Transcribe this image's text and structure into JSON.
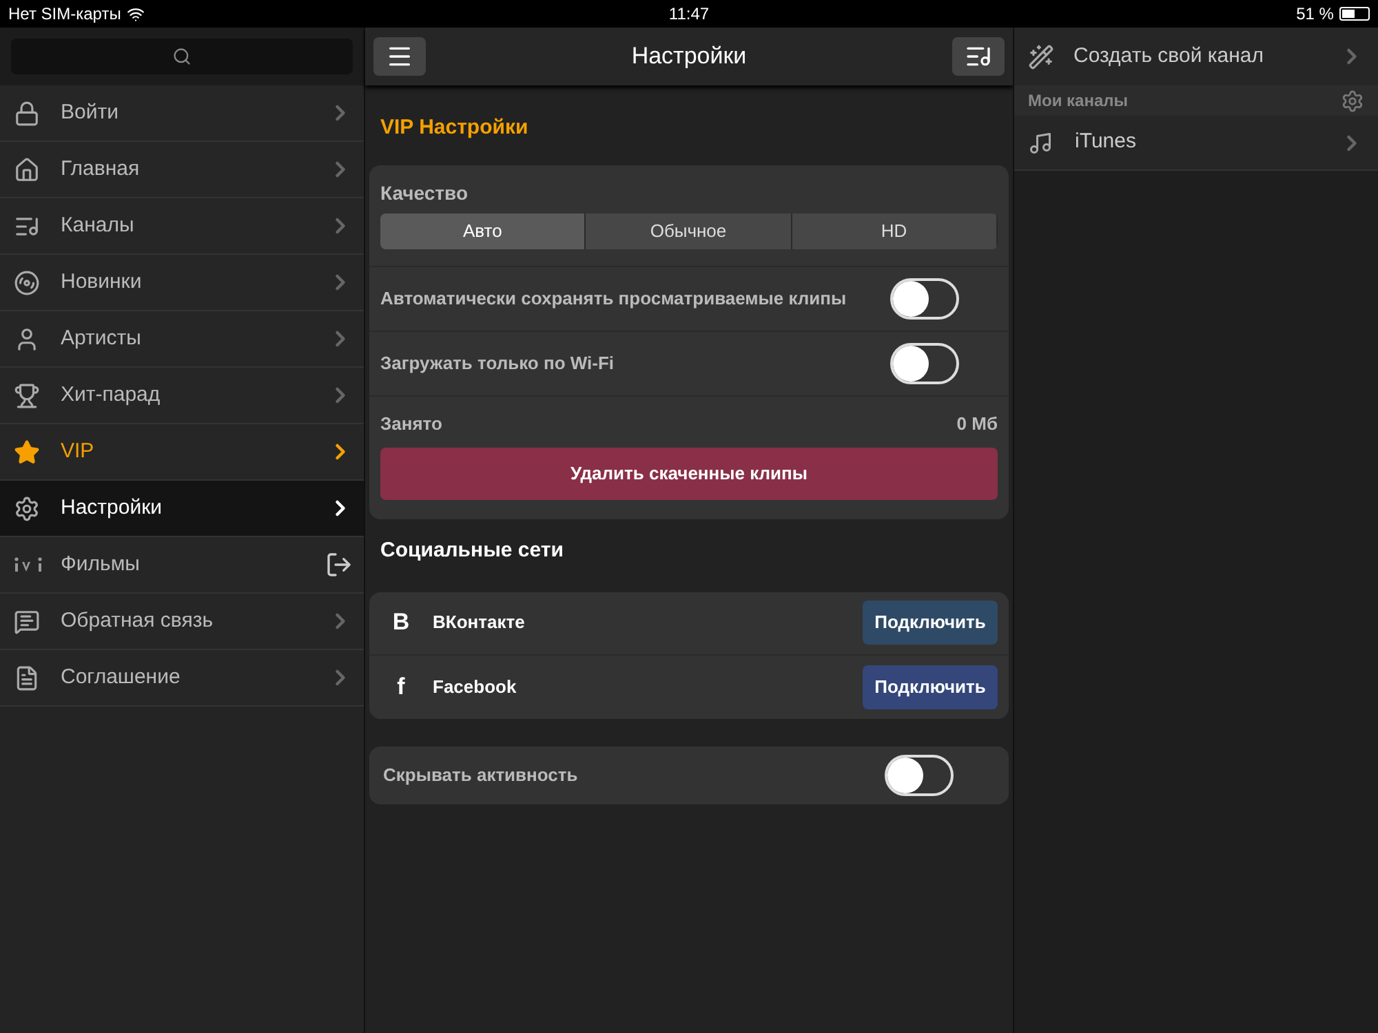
{
  "status_bar": {
    "carrier": "Нет SIM-карты",
    "time": "11:47",
    "battery": "51 %"
  },
  "sidebar": {
    "items": [
      {
        "label": "Войти",
        "selected": false,
        "accent": false,
        "kind": "chevron"
      },
      {
        "label": "Главная",
        "selected": false,
        "accent": false,
        "kind": "chevron"
      },
      {
        "label": "Каналы",
        "selected": false,
        "accent": false,
        "kind": "chevron"
      },
      {
        "label": "Новинки",
        "selected": false,
        "accent": false,
        "kind": "chevron"
      },
      {
        "label": "Артисты",
        "selected": false,
        "accent": false,
        "kind": "chevron"
      },
      {
        "label": "Хит-парад",
        "selected": false,
        "accent": false,
        "kind": "chevron"
      },
      {
        "label": "VIP",
        "selected": false,
        "accent": true,
        "kind": "chevron"
      },
      {
        "label": "Настройки",
        "selected": true,
        "accent": false,
        "kind": "chevron"
      },
      {
        "label": "Фильмы",
        "selected": false,
        "accent": false,
        "kind": "external"
      },
      {
        "label": "Обратная связь",
        "selected": false,
        "accent": false,
        "kind": "chevron"
      },
      {
        "label": "Соглашение",
        "selected": false,
        "accent": false,
        "kind": "chevron"
      }
    ]
  },
  "header": {
    "title": "Настройки"
  },
  "vip": {
    "title": "VIP Настройки",
    "quality_label": "Качество",
    "quality_options": [
      {
        "label": "Авто",
        "selected": true
      },
      {
        "label": "Обычное",
        "selected": false
      },
      {
        "label": "HD",
        "selected": false
      }
    ],
    "toggles": [
      {
        "label": "Автоматически сохранять просматриваемые клипы",
        "on": false
      },
      {
        "label": "Загружать только по Wi-Fi",
        "on": false
      }
    ],
    "storage_label": "Занято",
    "storage_value": "0 Мб",
    "delete_button": "Удалить скаченные клипы"
  },
  "social": {
    "title": "Социальные сети",
    "networks": [
      {
        "label": "ВКонтакте",
        "badge": "В",
        "button": "Подключить"
      },
      {
        "label": "Facebook",
        "badge": "f",
        "button": "Подключить"
      }
    ]
  },
  "privacy": {
    "label": "Скрывать активность",
    "on": false
  },
  "channels": {
    "create": "Создать свой канал",
    "section": "Мои каналы",
    "items": [
      "iTunes"
    ]
  }
}
